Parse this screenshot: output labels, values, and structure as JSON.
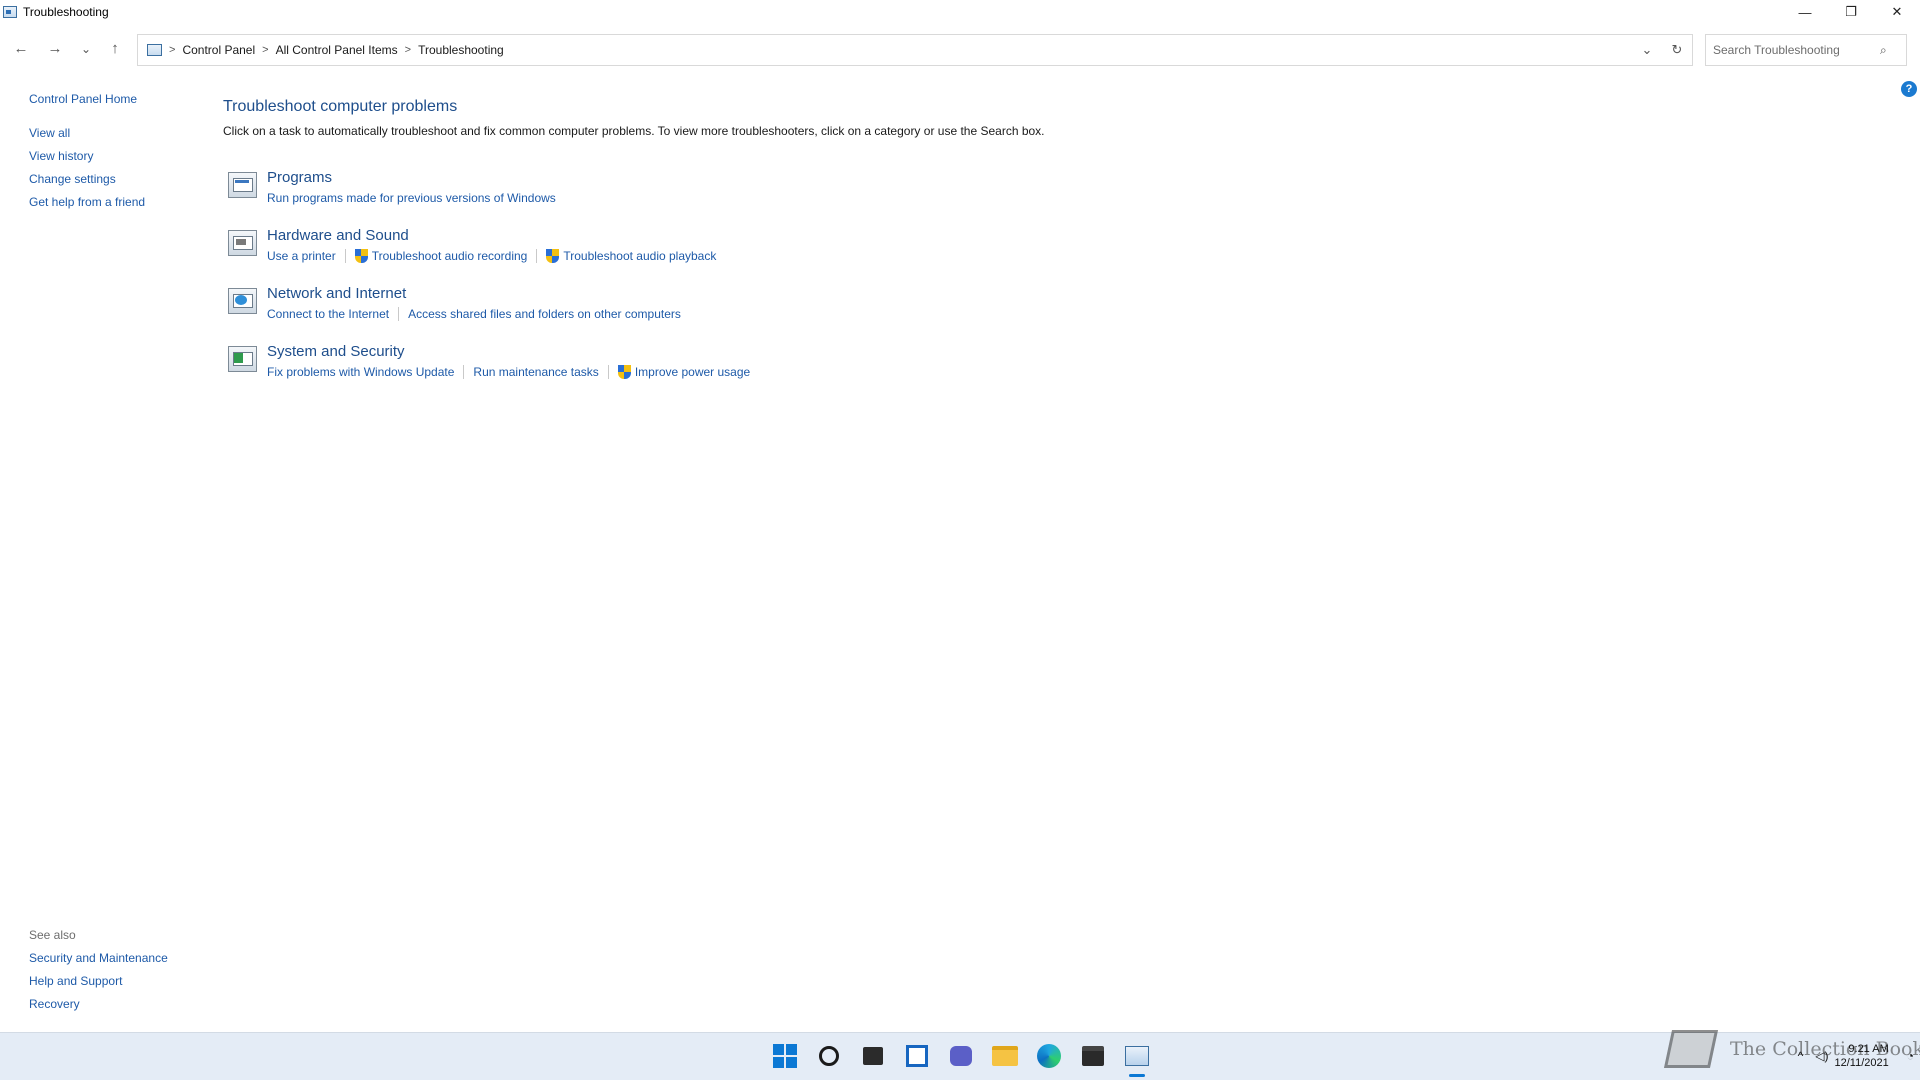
{
  "window": {
    "title": "Troubleshooting",
    "minimize": "—",
    "restore": "❐",
    "close": "✕"
  },
  "nav": {
    "back": "←",
    "forward": "→",
    "recent": "⌄",
    "up": "↑",
    "breadcrumb": [
      "Control Panel",
      "All Control Panel Items",
      "Troubleshooting"
    ],
    "dropdown": "⌄",
    "refresh": "↻",
    "search_placeholder": "Search Troubleshooting",
    "search_icon": "⌕"
  },
  "sidebar": {
    "home": "Control Panel Home",
    "links": [
      "View all",
      "View history",
      "Change settings",
      "Get help from a friend"
    ],
    "see_also_title": "See also",
    "see_also": [
      "Security and Maintenance",
      "Help and Support",
      "Recovery"
    ]
  },
  "main": {
    "title": "Troubleshoot computer problems",
    "description": "Click on a task to automatically troubleshoot and fix common computer problems. To view more troubleshooters, click on a category or use the Search box.",
    "categories": [
      {
        "title": "Programs",
        "icon": "programs-icon",
        "tasks": [
          {
            "label": "Run programs made for previous versions of Windows",
            "shield": false
          }
        ]
      },
      {
        "title": "Hardware and Sound",
        "icon": "hardware-sound-icon",
        "tasks": [
          {
            "label": "Use a printer",
            "shield": false
          },
          {
            "label": "Troubleshoot audio recording",
            "shield": true
          },
          {
            "label": "Troubleshoot audio playback",
            "shield": true
          }
        ]
      },
      {
        "title": "Network and Internet",
        "icon": "network-icon",
        "tasks": [
          {
            "label": "Connect to the Internet",
            "shield": false
          },
          {
            "label": "Access shared files and folders on other computers",
            "shield": false
          }
        ]
      },
      {
        "title": "System and Security",
        "icon": "system-security-icon",
        "tasks": [
          {
            "label": "Fix problems with Windows Update",
            "shield": false
          },
          {
            "label": "Run maintenance tasks",
            "shield": false
          },
          {
            "label": "Improve power usage",
            "shield": true
          }
        ]
      }
    ],
    "help": "?"
  },
  "taskbar": {
    "apps": [
      "start-icon",
      "search-icon",
      "task-view-icon",
      "widgets-icon",
      "chat-icon",
      "file-explorer-icon",
      "edge-icon",
      "store-icon",
      "control-panel-icon"
    ],
    "watermark": "The Collection Book",
    "time": "9:21 AM",
    "date": "12/11/2021",
    "colors": {
      "accent": "#0b78d4",
      "link": "#1e5aa8",
      "heading": "#1e4e8c"
    }
  }
}
